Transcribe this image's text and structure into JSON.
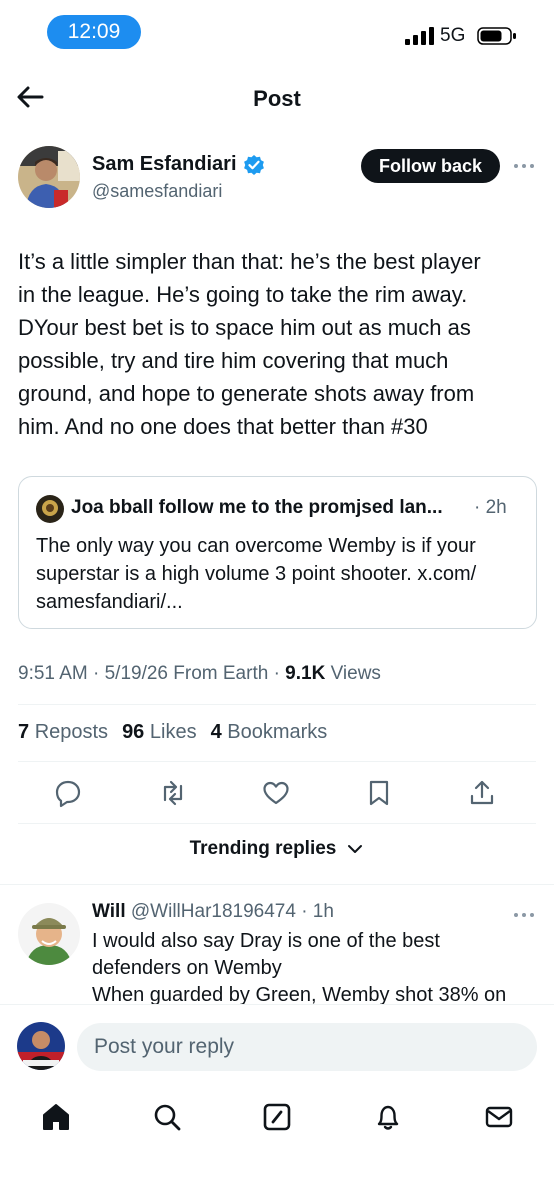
{
  "status": {
    "time": "12:09",
    "network": "5G"
  },
  "header": {
    "title": "Post"
  },
  "author": {
    "name": "Sam Esfandiari",
    "handle": "@samesfandiari",
    "follow_label": "Follow back"
  },
  "post": {
    "text": "It’s a little simpler than that: he’s the best player\nin the league. He’s going to take the rim away.\nDYour best bet is to space him out as much as\npossible, try and tire him covering that much\nground, and hope to generate shots away from\nhim.  And no one does that better than #30"
  },
  "quote": {
    "name": "Joa bball follow me to the promjsed lan...",
    "time": "· 2h",
    "text": "The only way you can overcome Wemby is if your superstar is a high volume 3 point shooter. x.com/ samesfandiari/..."
  },
  "meta": {
    "timestamp": "9:51 AM · 5/19/26 From Earth · ",
    "views_count": "9.1K",
    "views_label": " Views"
  },
  "stats": [
    {
      "count": "7",
      "label": "Reposts"
    },
    {
      "count": "96",
      "label": "Likes"
    },
    {
      "count": "4",
      "label": "Bookmarks"
    }
  ],
  "actions": [
    "reply-icon",
    "repost-icon",
    "like-icon",
    "bookmark-icon",
    "share-icon"
  ],
  "trending": {
    "label": "Trending replies"
  },
  "reply": {
    "name": "Will",
    "handle": "@WillHar18196474 · 1h",
    "text": "I would also say Dray is one of the best\ndefenders on Wemby\nWhen guarded by Green, Wemby shot 38% on"
  },
  "composer": {
    "placeholder": "Post your reply"
  },
  "tabbar": [
    "home-icon",
    "search-icon",
    "compose-icon",
    "notifications-icon",
    "messages-icon"
  ],
  "colors": {
    "accent": "#1d9bf0",
    "text": "#0f1419",
    "muted": "#536471",
    "pill": "#1d8df0"
  }
}
